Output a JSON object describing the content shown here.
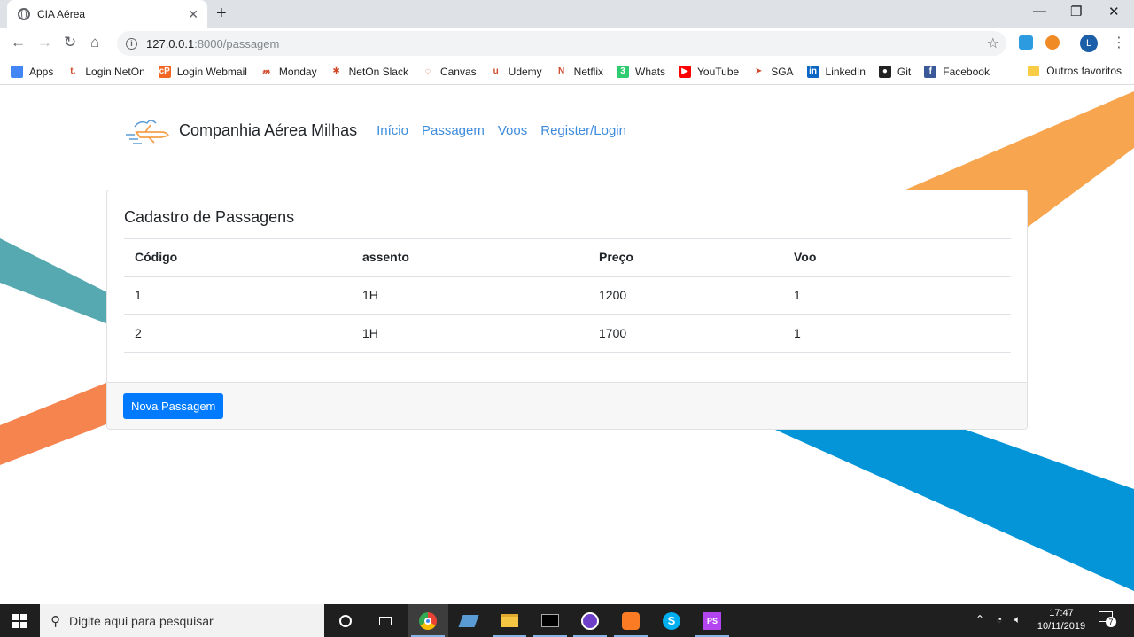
{
  "browser": {
    "tab_title": "CIA Aérea",
    "tab_close": "✕",
    "new_tab": "+",
    "window": {
      "minimize": "—",
      "restore": "❐",
      "close": "✕"
    },
    "url_host": "127.0.0.1",
    "url_rest": ":8000/passagem",
    "profile_initial": "L",
    "bookmarks": [
      {
        "label": "Apps",
        "icon": "apps-grid-icon",
        "color": "#4285f4",
        "glyph": ""
      },
      {
        "label": "Login NetOn",
        "icon": "neton-icon",
        "color": "#ffffff",
        "glyph": "t."
      },
      {
        "label": "Login Webmail",
        "icon": "webmail-icon",
        "color": "#f26522",
        "glyph": "cP"
      },
      {
        "label": "Monday",
        "icon": "monday-icon",
        "color": "#ffffff",
        "glyph": "𝓂"
      },
      {
        "label": "NetOn Slack",
        "icon": "slack-icon",
        "color": "#ffffff",
        "glyph": "✱"
      },
      {
        "label": "Canvas",
        "icon": "canvas-icon",
        "color": "#ffffff",
        "glyph": "◌"
      },
      {
        "label": "Udemy",
        "icon": "udemy-icon",
        "color": "#ffffff",
        "glyph": "u"
      },
      {
        "label": "Netflix",
        "icon": "netflix-icon",
        "color": "#ffffff",
        "glyph": "N"
      },
      {
        "label": "Whats",
        "icon": "whatsapp-icon",
        "color": "#2ecc71",
        "glyph": "3"
      },
      {
        "label": "YouTube",
        "icon": "youtube-icon",
        "color": "#ff0000",
        "glyph": "▶"
      },
      {
        "label": "SGA",
        "icon": "sga-icon",
        "color": "#ffffff",
        "glyph": "➤"
      },
      {
        "label": "LinkedIn",
        "icon": "linkedin-icon",
        "color": "#0a66c2",
        "glyph": "in"
      },
      {
        "label": "Git",
        "icon": "github-icon",
        "color": "#222222",
        "glyph": "●"
      },
      {
        "label": "Facebook",
        "icon": "facebook-icon",
        "color": "#3b5998",
        "glyph": "f"
      }
    ],
    "other_bookmarks": "Outros favoritos"
  },
  "site": {
    "brand": "Companhia Aérea Milhas",
    "nav": [
      "Início",
      "Passagem",
      "Voos",
      "Register/Login"
    ]
  },
  "card": {
    "title": "Cadastro de Passagens",
    "columns": [
      "Código",
      "assento",
      "Preço",
      "Voo"
    ],
    "rows": [
      [
        "1",
        "1H",
        "1200",
        "1"
      ],
      [
        "2",
        "1H",
        "1700",
        "1"
      ]
    ],
    "button": "Nova Passagem"
  },
  "taskbar": {
    "search_placeholder": "Digite aqui para pesquisar",
    "time": "17:47",
    "date": "10/11/2019",
    "notifications": "7"
  },
  "colors": {
    "stripe_teal": "#56a9b0",
    "stripe_orange_right": "#f7a64f",
    "stripe_orange_left": "#f5844f",
    "stripe_blue": "#0395d8",
    "link": "#3d8bdc",
    "primary": "#007bff"
  }
}
